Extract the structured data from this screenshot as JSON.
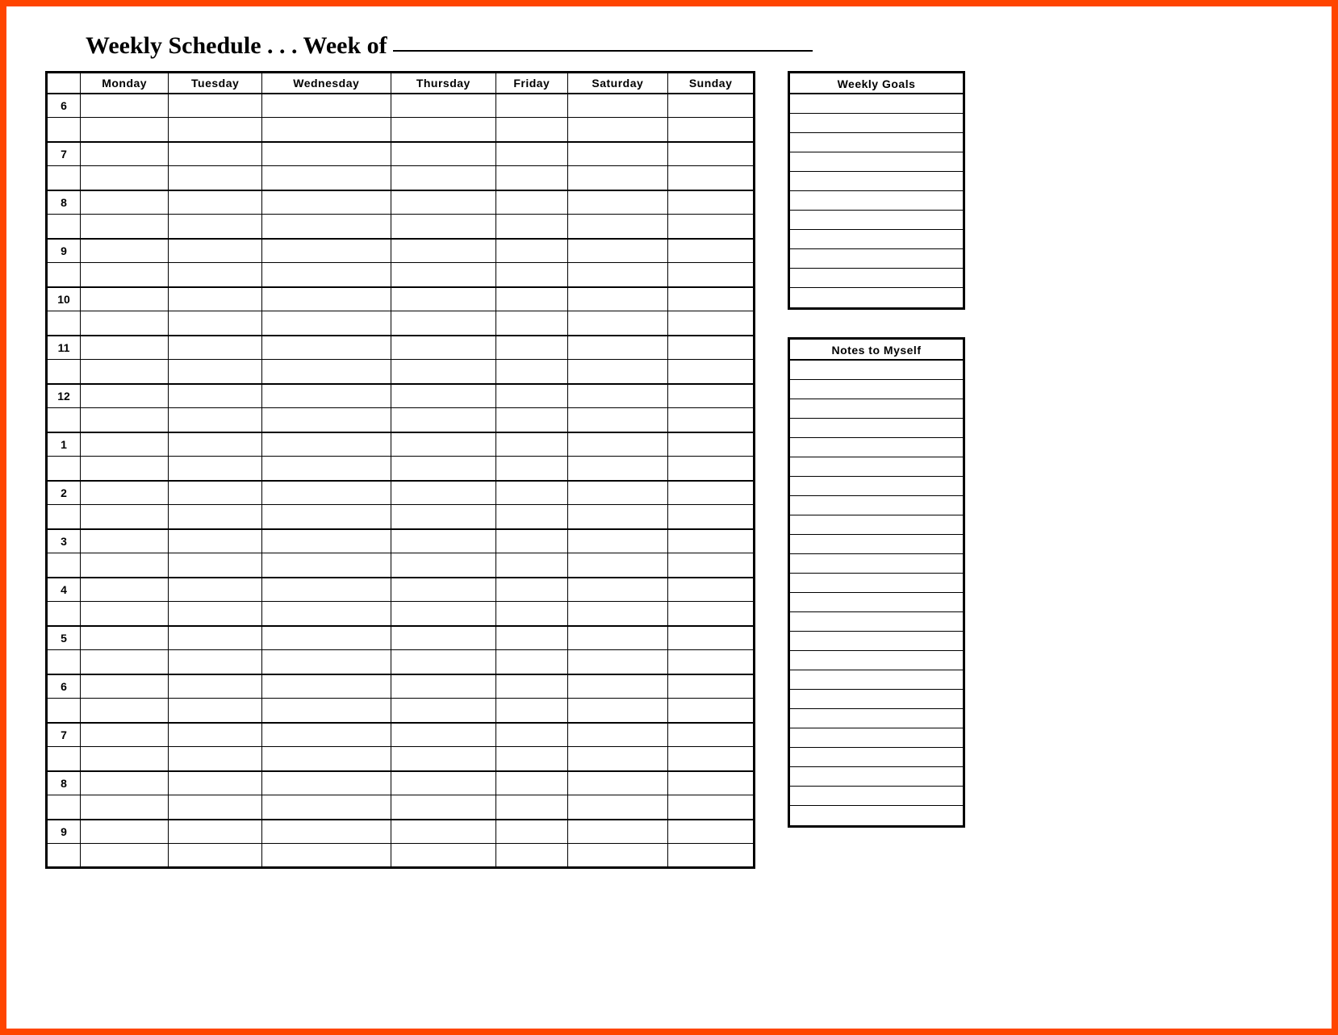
{
  "title_prefix": "Weekly Schedule . . . Week of ",
  "days": [
    "Monday",
    "Tuesday",
    "Wednesday",
    "Thursday",
    "Friday",
    "Saturday",
    "Sunday"
  ],
  "hours": [
    "6",
    "7",
    "8",
    "9",
    "10",
    "11",
    "12",
    "1",
    "2",
    "3",
    "4",
    "5",
    "6",
    "7",
    "8",
    "9"
  ],
  "side": {
    "goals_title": "Weekly Goals",
    "goals_lines": 11,
    "notes_title": "Notes to Myself",
    "notes_lines": 24
  }
}
